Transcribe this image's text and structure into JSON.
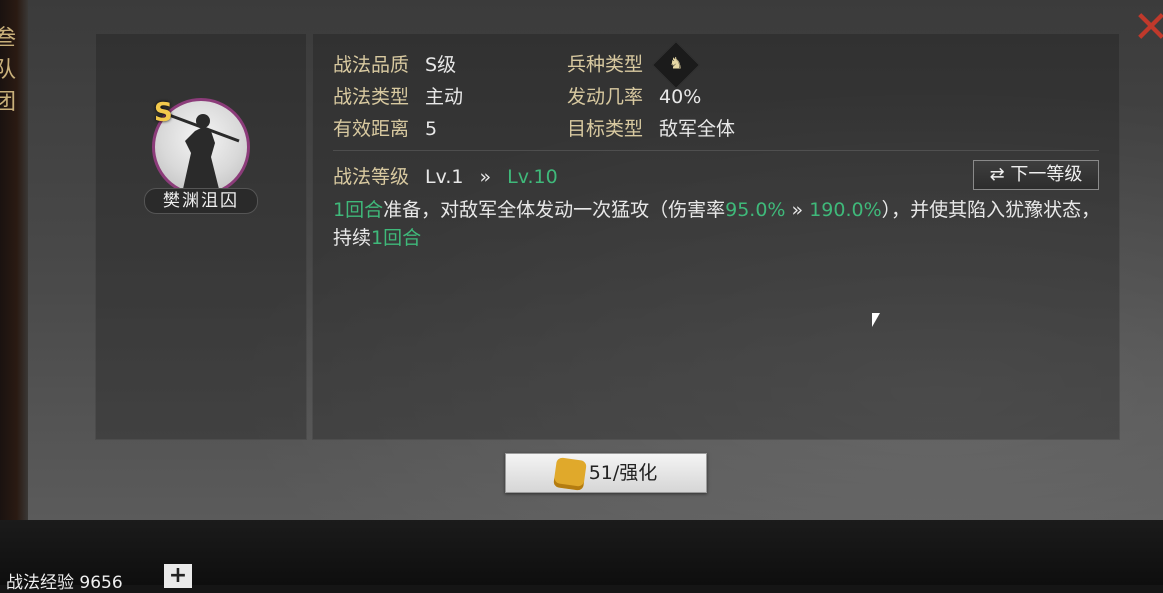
{
  "dialog": {
    "close_icon": "close-icon",
    "hero": {
      "grade": "S",
      "name": "樊渊沮囚"
    },
    "stats": {
      "quality_label": "战法品质",
      "quality_value": "S级",
      "unit_type_label": "兵种类型",
      "unit_type_icon": "cavalry-horse-icon",
      "type_label": "战法类型",
      "type_value": "主动",
      "rate_label": "发动几率",
      "rate_value": "40%",
      "range_label": "有效距离",
      "range_value": "5",
      "target_label": "目标类型",
      "target_value": "敌军全体"
    },
    "level": {
      "label": "战法等级",
      "current": "Lv.1",
      "arrow": "»",
      "max": "Lv.10",
      "next_button": "下一等级",
      "next_icon": "swap-arrows-icon"
    },
    "description": {
      "p1_green": "1回合",
      "p1": "准备，对敌军全体发动一次猛攻（伤害率",
      "p2_green": "95.0%",
      "p2_arrow": " » ",
      "p3_green": "190.0%",
      "p3": "），并使其陷入犹豫状态，持续",
      "p4_green": "1回合"
    },
    "enhance_button": "51/强化",
    "enhance_icon": "fist-icon"
  },
  "bottom": {
    "exp_text": "战法经验 9656",
    "plus_label": "+"
  }
}
